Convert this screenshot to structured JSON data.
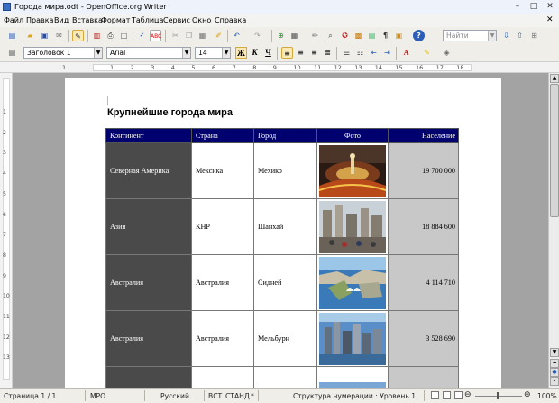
{
  "window": {
    "title": "Города мира.odt - OpenOffice.org Writer"
  },
  "menu": [
    "Файл",
    "Правка",
    "Вид",
    "Вставка",
    "Формат",
    "Таблица",
    "Сервис",
    "Окно",
    "Справка"
  ],
  "toolbar": {
    "search_placeholder": "Найти"
  },
  "format": {
    "style": "Заголовок 1",
    "font": "Arial",
    "size": "14",
    "bold": "Ж",
    "italic": "К",
    "underline": "Ч"
  },
  "ruler": {
    "h_labels": [
      "1",
      "1",
      "2",
      "3",
      "4",
      "5",
      "6",
      "7",
      "8",
      "9",
      "10",
      "11",
      "12",
      "13",
      "14",
      "15",
      "16",
      "17",
      "18"
    ],
    "v_labels": [
      "1",
      "2",
      "3",
      "4",
      "5",
      "6",
      "7",
      "8",
      "9",
      "10",
      "11",
      "12",
      "13"
    ]
  },
  "document": {
    "heading": "Крупнейшие города мира",
    "columns": [
      "Континент",
      "Страна",
      "Город",
      "Фото",
      "Население"
    ],
    "rows": [
      {
        "continent": "Северная Америка",
        "country": "Мексика",
        "city": "Мехико",
        "population": "19 700 000",
        "photo": "mexico-city-photo"
      },
      {
        "continent": "Азия",
        "country": "КНР",
        "city": "Шанхай",
        "population": "18 884 600",
        "photo": "shanghai-photo"
      },
      {
        "continent": "Австралия",
        "country": "Австралия",
        "city": "Сидней",
        "population": "4 114 710",
        "photo": "sydney-photo"
      },
      {
        "continent": "Австралия",
        "country": "Австралия",
        "city": "Мельбурн",
        "population": "3 528 690",
        "photo": "melbourne-photo"
      }
    ]
  },
  "status": {
    "page": "Страница 1 / 1",
    "style": "МРО",
    "lang": "Русский",
    "ins": "ВСТ",
    "mode": "СТАНД",
    "star": "*",
    "outline": "Структура нумерации : Уровень 1",
    "zoom": "100%"
  }
}
